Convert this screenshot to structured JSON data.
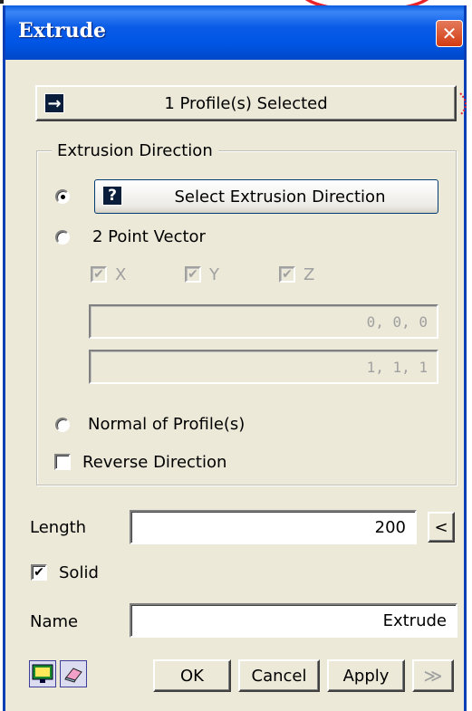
{
  "window": {
    "title": "Extrude",
    "close_glyph": "✕"
  },
  "profile_button": {
    "label": "1 Profile(s) Selected",
    "icon": "→"
  },
  "extrusion_direction": {
    "group_title": "Extrusion Direction",
    "select_button": {
      "label": "Select Extrusion Direction",
      "icon": "?"
    },
    "two_point_vector": {
      "label": "2 Point Vector",
      "axes": [
        {
          "label": "X",
          "checked": true
        },
        {
          "label": "Y",
          "checked": true
        },
        {
          "label": "Z",
          "checked": true
        }
      ],
      "point_1": "0, 0, 0",
      "point_2": "1, 1, 1"
    },
    "normal_of_profiles_label": "Normal of Profile(s)",
    "reverse_direction_label": "Reverse Direction",
    "selected_option": "select_extrusion_direction"
  },
  "length": {
    "label": "Length",
    "value": "200",
    "pick_button": "<"
  },
  "solid": {
    "label": "Solid",
    "checked": true,
    "mark": "✔"
  },
  "name": {
    "label": "Name",
    "value": "Extrude"
  },
  "actions": {
    "ok": "OK",
    "cancel": "Cancel",
    "apply": "Apply",
    "more": "≫"
  },
  "colors": {
    "title_bar": "#0055e5",
    "dialog_bg": "#ece9d8",
    "close_red": "#d23b12",
    "highlight_red": "#e8232a"
  }
}
